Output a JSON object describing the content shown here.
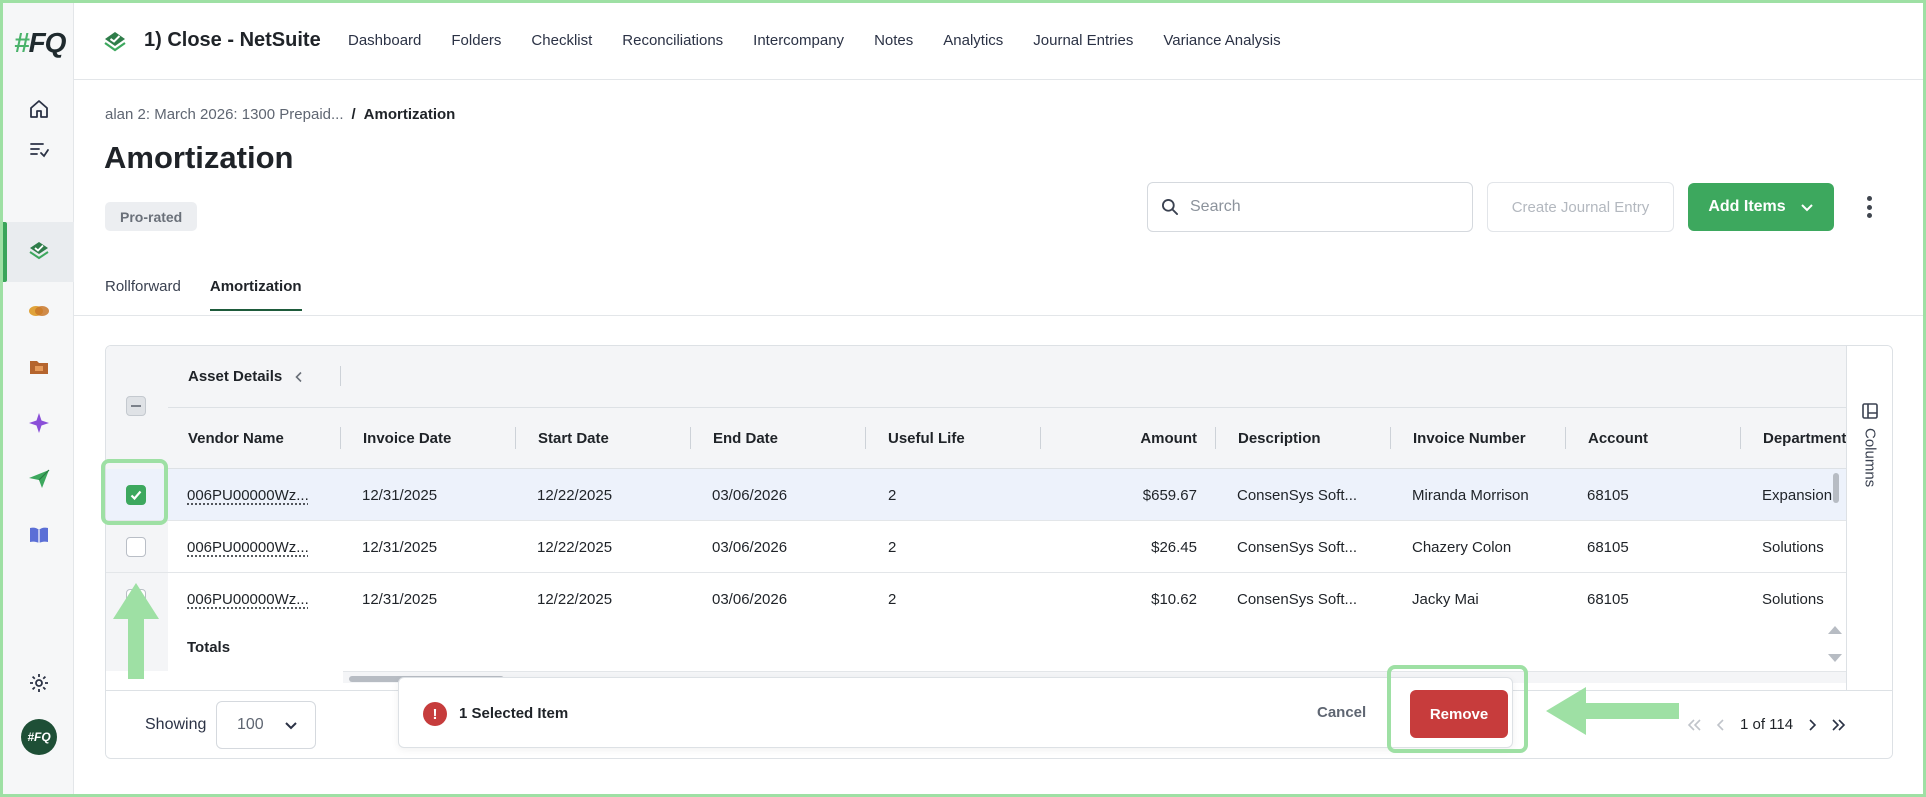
{
  "brand": {
    "logo_hash": "#",
    "logo_text": "FQ",
    "avatar_text": "#FQ"
  },
  "app": {
    "title": "1) Close - NetSuite"
  },
  "nav": {
    "items": [
      {
        "label": "Dashboard"
      },
      {
        "label": "Folders"
      },
      {
        "label": "Checklist"
      },
      {
        "label": "Reconciliations"
      },
      {
        "label": "Intercompany"
      },
      {
        "label": "Notes"
      },
      {
        "label": "Analytics"
      },
      {
        "label": "Journal Entries"
      },
      {
        "label": "Variance Analysis"
      }
    ]
  },
  "breadcrumb": {
    "parent": "alan 2: March 2026: 1300 Prepaid...",
    "separator": "/",
    "current": "Amortization"
  },
  "page": {
    "title": "Amortization",
    "badge": "Pro-rated"
  },
  "toolbar": {
    "search_placeholder": "Search",
    "create_journal_entry": "Create Journal Entry",
    "add_items": "Add Items"
  },
  "tabs": [
    {
      "label": "Rollforward",
      "active": false
    },
    {
      "label": "Amortization",
      "active": true
    }
  ],
  "table": {
    "group_label": "Asset Details",
    "columns": [
      "Vendor Name",
      "Invoice Date",
      "Start Date",
      "End Date",
      "Useful Life",
      "Amount",
      "Description",
      "Invoice Number",
      "Account",
      "Department"
    ],
    "rows": [
      {
        "checked": true,
        "cells": [
          "006PU00000Wz...",
          "12/31/2025",
          "12/22/2025",
          "03/06/2026",
          "2",
          "$659.67",
          "ConsenSys Soft...",
          "Miranda Morrison",
          "68105",
          "Expansion"
        ]
      },
      {
        "checked": false,
        "cells": [
          "006PU00000Wz...",
          "12/31/2025",
          "12/22/2025",
          "03/06/2026",
          "2",
          "$26.45",
          "ConsenSys Soft...",
          "Chazery Colon",
          "68105",
          "Solutions"
        ]
      },
      {
        "checked": false,
        "cells": [
          "006PU00000Wz...",
          "12/31/2025",
          "12/22/2025",
          "03/06/2026",
          "2",
          "$10.62",
          "ConsenSys Soft...",
          "Jacky Mai",
          "68105",
          "Solutions"
        ]
      }
    ],
    "totals_label": "Totals",
    "columns_panel_label": "Columns"
  },
  "footer": {
    "showing_label": "Showing",
    "page_size": "100",
    "page_info": "1 of 114"
  },
  "selection_bar": {
    "count_text": "1 Selected Item",
    "alert_glyph": "!",
    "cancel": "Cancel",
    "remove": "Remove"
  },
  "colors": {
    "accent_green": "#3da85e",
    "danger_red": "#c73c3c",
    "annotation_green": "#9ee0a4"
  }
}
